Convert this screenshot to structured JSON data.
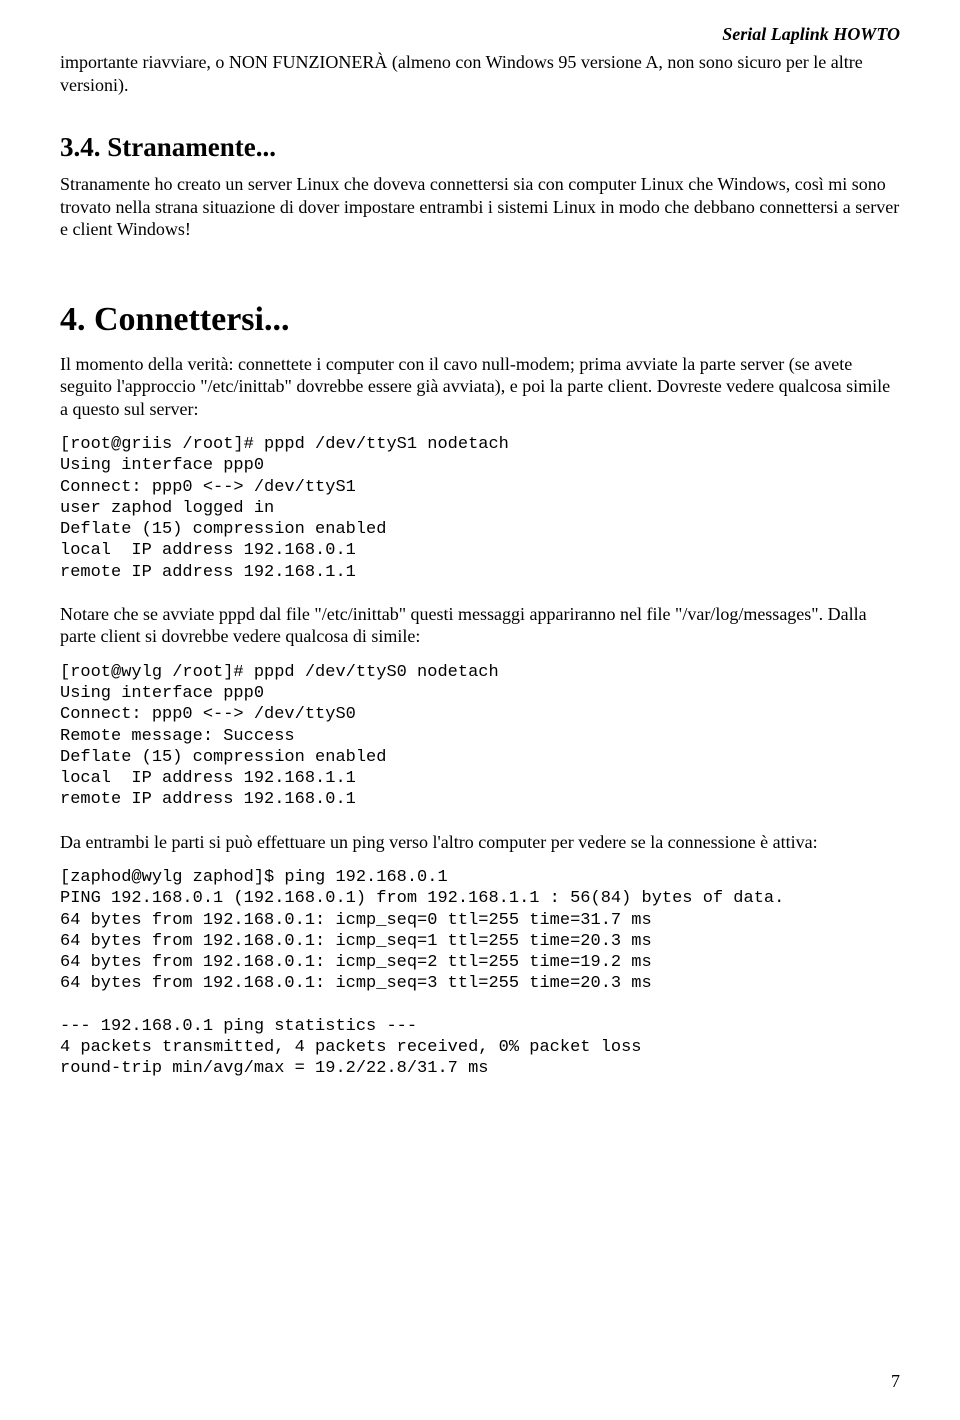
{
  "header": {
    "doc_title": "Serial Laplink HOWTO"
  },
  "intro_para": "importante riavviare, o NON FUNZIONERÀ (almeno con Windows 95 versione A, non sono sicuro per le altre versioni).",
  "sec34": {
    "title": "3.4. Stranamente...",
    "para": "Stranamente ho creato un server Linux che doveva connettersi sia con computer Linux che Windows, così mi sono trovato nella strana situazione di dover impostare entrambi i sistemi Linux in modo che debbano connettersi a server e client Windows!"
  },
  "sec4": {
    "title": "4. Connettersi...",
    "para1": "Il momento della verità: connettete i computer con il cavo null-modem; prima avviate la parte server (se avete seguito l'approccio \"/etc/inittab\" dovrebbe essere già avviata), e poi la parte client. Dovreste vedere qualcosa simile a questo sul server:",
    "code1": "[root@griis /root]# pppd /dev/ttyS1 nodetach\nUsing interface ppp0\nConnect: ppp0 <--> /dev/ttyS1\nuser zaphod logged in\nDeflate (15) compression enabled\nlocal  IP address 192.168.0.1\nremote IP address 192.168.1.1",
    "para2": "Notare che se avviate pppd dal file \"/etc/inittab\" questi messaggi appariranno nel file \"/var/log/messages\". Dalla parte client si dovrebbe vedere qualcosa di simile:",
    "code2": "[root@wylg /root]# pppd /dev/ttyS0 nodetach\nUsing interface ppp0\nConnect: ppp0 <--> /dev/ttyS0\nRemote message: Success\nDeflate (15) compression enabled\nlocal  IP address 192.168.1.1\nremote IP address 192.168.0.1",
    "para3": "Da entrambi le parti si può effettuare un ping verso l'altro computer per vedere se la connessione è attiva:",
    "code3": "[zaphod@wylg zaphod]$ ping 192.168.0.1\nPING 192.168.0.1 (192.168.0.1) from 192.168.1.1 : 56(84) bytes of data.\n64 bytes from 192.168.0.1: icmp_seq=0 ttl=255 time=31.7 ms\n64 bytes from 192.168.0.1: icmp_seq=1 ttl=255 time=20.3 ms\n64 bytes from 192.168.0.1: icmp_seq=2 ttl=255 time=19.2 ms\n64 bytes from 192.168.0.1: icmp_seq=3 ttl=255 time=20.3 ms\n\n--- 192.168.0.1 ping statistics ---\n4 packets transmitted, 4 packets received, 0% packet loss\nround-trip min/avg/max = 19.2/22.8/31.7 ms"
  },
  "page_number": "7"
}
